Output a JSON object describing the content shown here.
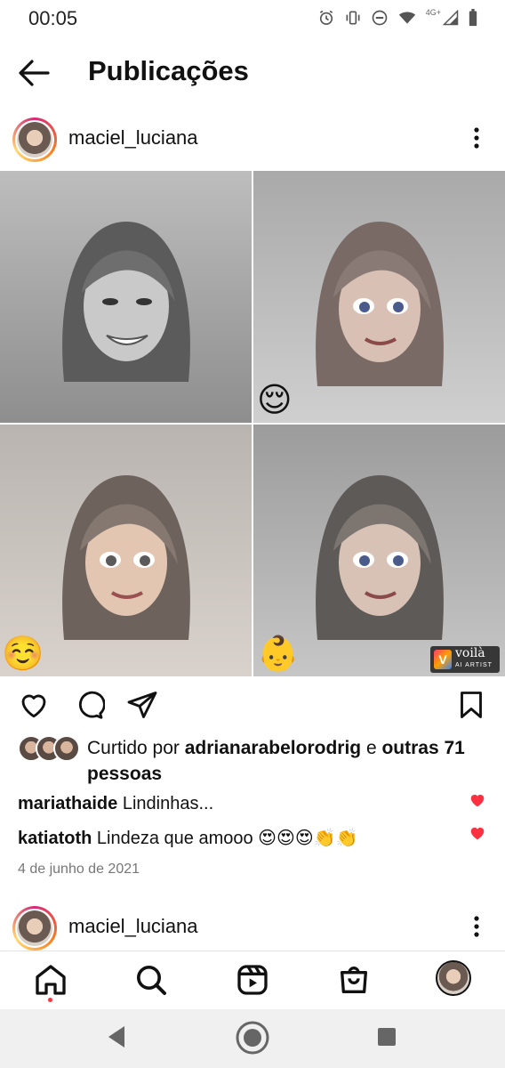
{
  "status_bar": {
    "time": "00:05",
    "network_label": "4G+",
    "icons": [
      "alarm-icon",
      "vibrate-icon",
      "do-not-disturb-icon",
      "wifi-icon",
      "signal-icon",
      "battery-icon"
    ]
  },
  "app_bar": {
    "title": "Publicações",
    "back_icon": "arrow-left-icon"
  },
  "post": {
    "username": "maciel_luciana",
    "more_icon": "more-vertical-icon",
    "photos": [
      {
        "emoji": "",
        "style": "bw-photo"
      },
      {
        "emoji": "😌",
        "style": "cartoon"
      },
      {
        "emoji": "☺️",
        "style": "cartoon"
      },
      {
        "emoji": "👶",
        "style": "cartoon"
      }
    ],
    "watermark": {
      "brand": "voilà",
      "sub": "AI ARTIST",
      "logo": "V"
    },
    "actions": [
      "heart-icon",
      "comment-icon",
      "share-icon",
      "bookmark-icon"
    ],
    "likes": {
      "prefix": "Curtido por ",
      "user": "adrianarabelorodrig",
      "middle": " e ",
      "others": "outras 71 pessoas"
    },
    "comments": [
      {
        "user": "mariathaide",
        "text": "Lindinhas..."
      },
      {
        "user": "katiatoth",
        "text": "Lindeza que amooo 😍😍😍👏👏"
      }
    ],
    "date": "4 de junho de 2021"
  },
  "next_post": {
    "username": "maciel_luciana"
  },
  "bottom_nav": [
    "home-icon",
    "search-icon",
    "reels-icon",
    "shop-icon",
    "profile-avatar"
  ],
  "colors": {
    "like_red": "#ff3040",
    "story_ring": "#d62976"
  }
}
